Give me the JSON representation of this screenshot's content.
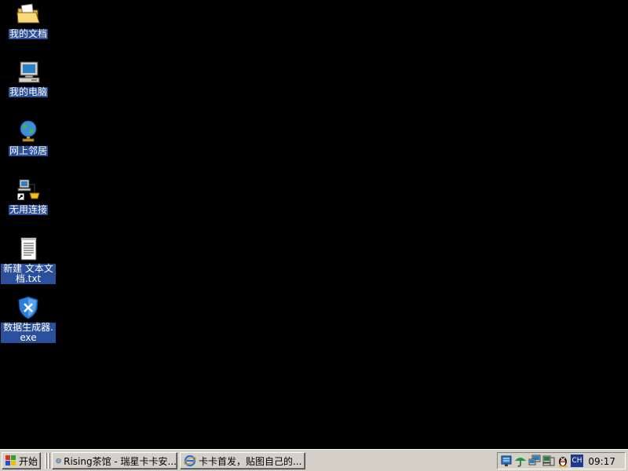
{
  "desktop": {
    "background_color": "#000000",
    "icons": [
      {
        "label": "我的文档",
        "icon": "my-documents-folder-icon"
      },
      {
        "label": "我的电脑",
        "icon": "my-computer-icon"
      },
      {
        "label": "网上邻居",
        "icon": "network-places-globe-icon"
      },
      {
        "label": "无用连接",
        "icon": "network-connection-shortcut-icon"
      },
      {
        "label": "新建 文本文档.txt",
        "icon": "text-document-icon"
      },
      {
        "label": "数据生成器.exe",
        "icon": "shield-exe-icon"
      }
    ]
  },
  "taskbar": {
    "start_label": "开始",
    "tasks": [
      {
        "label": "Rising茶馆 - 瑞星卡卡安...",
        "icon": "ie-icon"
      },
      {
        "label": "卡卡首发，贴图自己的...",
        "icon": "ie-icon"
      }
    ],
    "tray": {
      "icons": [
        "network-tray-icon",
        "umbrella-tray-icon",
        "monitor-tray-icon",
        "computer-tray-icon",
        "qq-penguin-icon"
      ],
      "lang": "CH",
      "clock": "09:17"
    }
  }
}
